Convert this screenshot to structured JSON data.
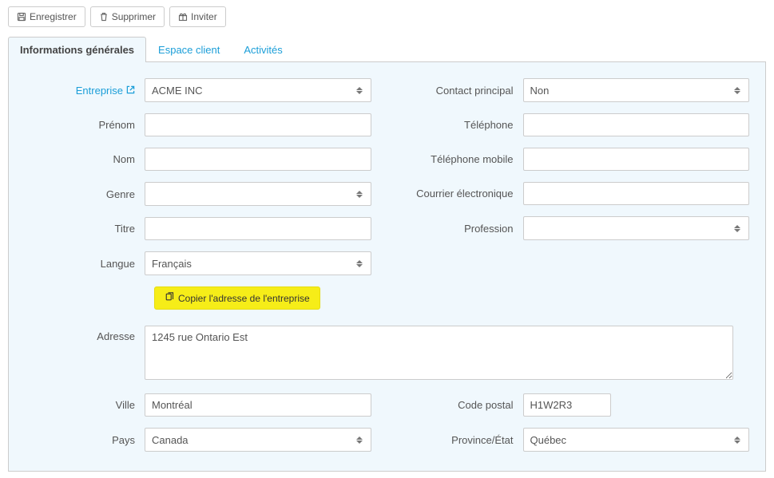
{
  "toolbar": {
    "save_label": "Enregistrer",
    "delete_label": "Supprimer",
    "invite_label": "Inviter"
  },
  "tabs": {
    "general": "Informations générales",
    "client_space": "Espace client",
    "activities": "Activités"
  },
  "labels": {
    "company": "Entreprise",
    "firstname": "Prénom",
    "lastname": "Nom",
    "gender": "Genre",
    "title": "Titre",
    "language": "Langue",
    "main_contact": "Contact principal",
    "phone": "Téléphone",
    "mobile": "Téléphone mobile",
    "email": "Courrier électronique",
    "profession": "Profession",
    "address": "Adresse",
    "city": "Ville",
    "postal": "Code postal",
    "country": "Pays",
    "province": "Province/État"
  },
  "values": {
    "company": "ACME INC",
    "firstname": "",
    "lastname": "",
    "gender": "",
    "title": "",
    "language": "Français",
    "main_contact": "Non",
    "phone": "",
    "mobile": "",
    "email": "",
    "profession": "",
    "address": "1245 rue Ontario Est",
    "city": "Montréal",
    "postal": "H1W2R3",
    "country": "Canada",
    "province": "Québec"
  },
  "actions": {
    "copy_address": "Copier l'adresse de l'entreprise"
  }
}
